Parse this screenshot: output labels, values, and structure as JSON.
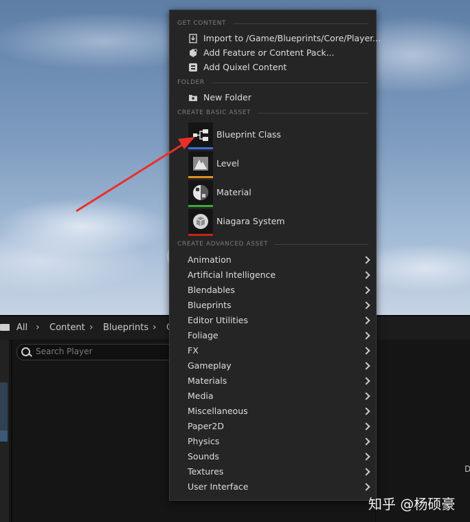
{
  "breadcrumb": {
    "items": [
      "All",
      "Content",
      "Blueprints",
      "C"
    ]
  },
  "search": {
    "placeholder": "Search Player"
  },
  "right_hint": "D",
  "menu": {
    "sections": {
      "get_content": "GET CONTENT",
      "folder": "FOLDER",
      "basic": "CREATE BASIC ASSET",
      "advanced": "CREATE ADVANCED ASSET"
    },
    "get_content_items": [
      {
        "label": "Import to /Game/Blueprints/Core/Player...",
        "icon": "import-icon"
      },
      {
        "label": "Add Feature or Content Pack...",
        "icon": "feature-pack-icon"
      },
      {
        "label": "Add Quixel Content",
        "icon": "quixel-icon"
      }
    ],
    "folder_items": [
      {
        "label": "New Folder",
        "icon": "new-folder-icon"
      }
    ],
    "basic_assets": [
      {
        "label": "Blueprint Class",
        "icon": "blueprint-class-icon",
        "accent": "#3b6fd8"
      },
      {
        "label": "Level",
        "icon": "level-icon",
        "accent": "#e0921d"
      },
      {
        "label": "Material",
        "icon": "material-icon",
        "accent": "#3aa93a"
      },
      {
        "label": "Niagara System",
        "icon": "niagara-system-icon",
        "accent": "#c8241c"
      }
    ],
    "advanced_assets": [
      "Animation",
      "Artificial Intelligence",
      "Blendables",
      "Blueprints",
      "Editor Utilities",
      "Foliage",
      "FX",
      "Gameplay",
      "Materials",
      "Media",
      "Miscellaneous",
      "Paper2D",
      "Physics",
      "Sounds",
      "Textures",
      "User Interface"
    ]
  },
  "watermark": "知乎 @杨硕豪",
  "colors": {
    "menu_bg": "#252525",
    "arrow": "#e8302a"
  }
}
